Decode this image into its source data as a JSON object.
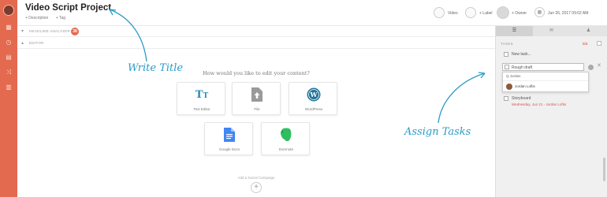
{
  "rail": {
    "icons": [
      "avatar",
      "grid-icon",
      "clock-icon",
      "trash-icon",
      "shuffle-icon",
      "chart-icon"
    ]
  },
  "header": {
    "title": "Video Script Project",
    "add_description": "+ Description",
    "add_tag": "+ Tag",
    "video_label": "Video",
    "label_label": "+ Label",
    "owner_label": "+ Owner",
    "date_label": "Jun 26, 2017 09:02 AM"
  },
  "sections": {
    "headline": {
      "label": "HEADLINE ANALYZER",
      "badge": "38"
    },
    "editor": {
      "label": "EDITOR"
    }
  },
  "editor": {
    "prompt": "How would you like to edit your content?",
    "options": [
      {
        "label": "Text Editor",
        "icon": "text-editor-icon"
      },
      {
        "label": "File",
        "icon": "file-upload-icon"
      },
      {
        "label": "WordPress",
        "icon": "wordpress-icon"
      },
      {
        "label": "Google Docs",
        "icon": "google-docs-icon"
      },
      {
        "label": "Evernote",
        "icon": "evernote-icon"
      }
    ],
    "add_text": "Add a Social Campaign"
  },
  "annotations": {
    "write_title": "Write Title",
    "assign_tasks": "Assign Tasks"
  },
  "panel": {
    "tabs": [
      "tasks-tab-icon",
      "comments-tab-icon",
      "people-tab-icon"
    ],
    "tasks_header": "TASKS",
    "tasks_count": "0/4",
    "new_task": "New task...",
    "editing_task": "Rough draft",
    "dropdown_search": "Q Jordan",
    "dropdown_person": "Jordan Loftis",
    "task_storyboard": "Storyboard",
    "task_storyboard_due": "Wednesday, Jun 21 - Jordan Loftis"
  },
  "colors": {
    "accent": "#e36a4f",
    "annotation": "#2a9bc9",
    "wordpress": "#21759b",
    "google_docs": "#4285f4",
    "evernote": "#2dbe60"
  }
}
